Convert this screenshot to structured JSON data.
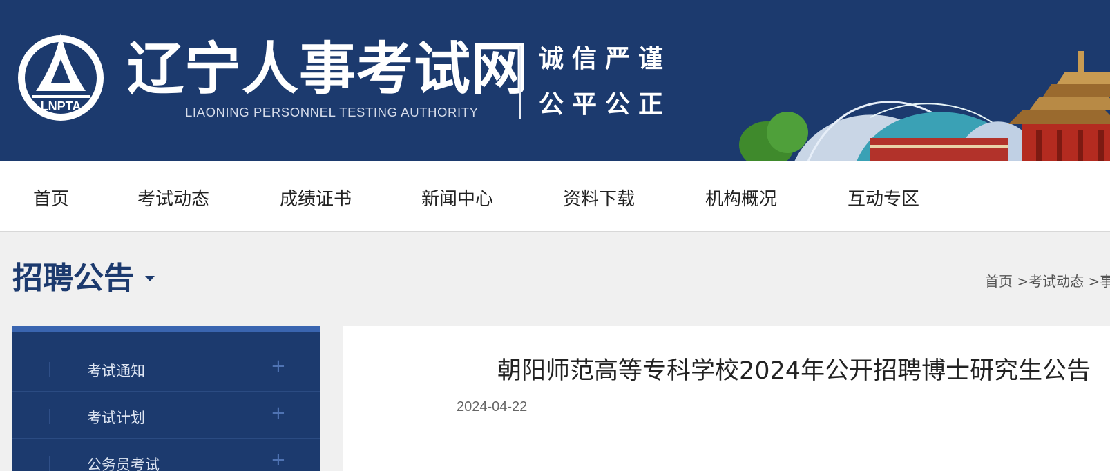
{
  "header": {
    "logo_text": "LNPTA",
    "title": "辽宁人事考试网",
    "subtitle": "LIAONING PERSONNEL TESTING AUTHORITY",
    "motto_line1": "诚信严谨",
    "motto_line2": "公平公正",
    "brand_color": "#1c3a6e"
  },
  "nav": {
    "items": [
      "首页",
      "考试动态",
      "成绩证书",
      "新闻中心",
      "资料下载",
      "机构概况",
      "互动专区"
    ]
  },
  "section": {
    "title": "招聘公告",
    "breadcrumb": [
      "首页",
      ">考试动态",
      ">事"
    ]
  },
  "sidebar": {
    "items": [
      {
        "label": "考试通知",
        "expand_icon": "plus-icon"
      },
      {
        "label": "考试计划",
        "expand_icon": "plus-icon"
      },
      {
        "label": "公务员考试",
        "expand_icon": "plus-icon"
      }
    ]
  },
  "article": {
    "title": "朝阳师范高等专科学校2024年公开招聘博士研究生公告",
    "date": "2024-04-22"
  }
}
